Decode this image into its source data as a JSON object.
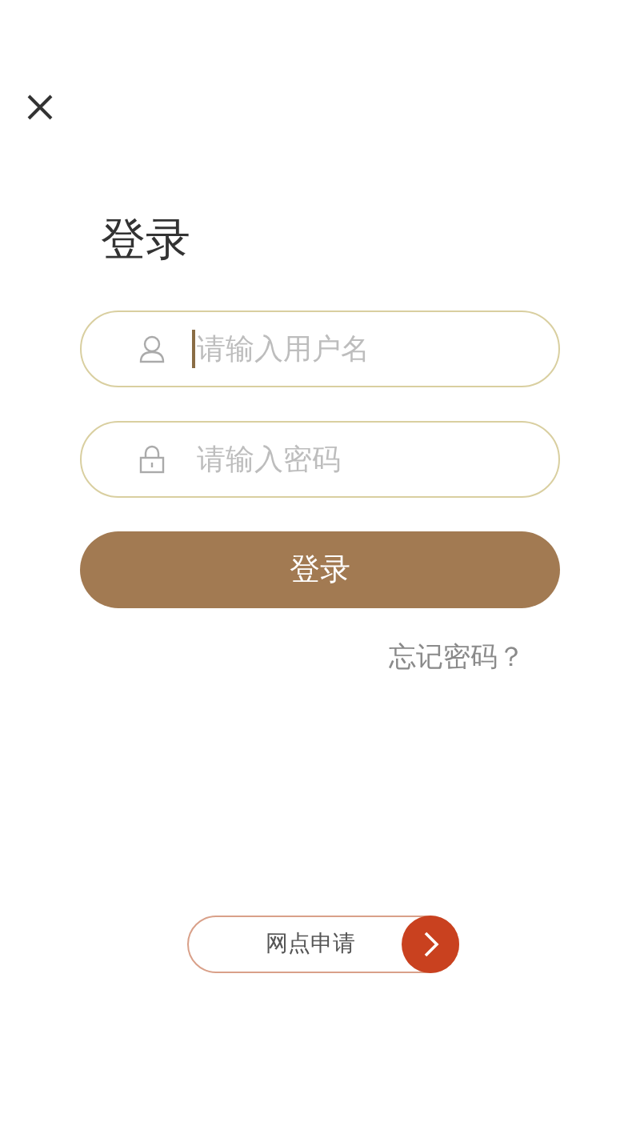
{
  "title": "登录",
  "fields": [
    {
      "kind": "user",
      "placeholder": "请输入用户名",
      "focused": true
    },
    {
      "kind": "lock",
      "placeholder": "请输入密码",
      "focused": false
    }
  ],
  "login_button": "登录",
  "forgot_link": "忘记密码？",
  "apply_button": "网点申请"
}
